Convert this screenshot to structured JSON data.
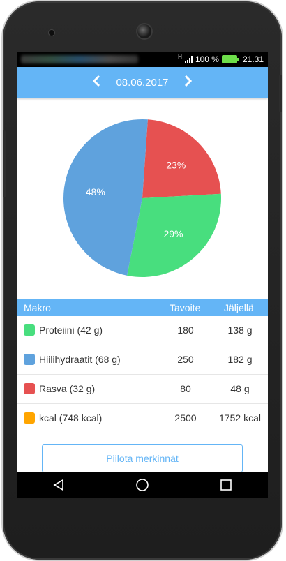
{
  "status": {
    "network": "H",
    "battery": "100 %",
    "time": "21.31"
  },
  "header": {
    "date": "08.06.2017",
    "prev_icon": "chevron-left-icon",
    "next_icon": "chevron-right-icon"
  },
  "chart_data": {
    "type": "pie",
    "slices": [
      {
        "label": "23%",
        "value": 23,
        "color": "#e65151"
      },
      {
        "label": "29%",
        "value": 29,
        "color": "#48de7e"
      },
      {
        "label": "48%",
        "value": 48,
        "color": "#5fa2dd"
      }
    ]
  },
  "table": {
    "headers": {
      "macro": "Makro",
      "target": "Tavoite",
      "remaining": "Jäljellä"
    },
    "rows": [
      {
        "label": "Proteiini (42 g)",
        "target": "180",
        "remaining": "138 g",
        "color": "#48de7e"
      },
      {
        "label": "Hiilihydraatit (68 g)",
        "target": "250",
        "remaining": "182 g",
        "color": "#5fa2dd"
      },
      {
        "label": "Rasva (32 g)",
        "target": "80",
        "remaining": "48 g",
        "color": "#e65151"
      },
      {
        "label": "kcal (748 kcal)",
        "target": "2500",
        "remaining": "1752 kcal",
        "color": "#ffa500"
      }
    ]
  },
  "hide_button": {
    "label": "Piilota merkinnät"
  },
  "navbar": {
    "back_icon": "back-triangle-icon",
    "home_icon": "home-circle-icon",
    "recents_icon": "recents-square-icon"
  },
  "colors": {
    "accent": "#64b5f6"
  }
}
